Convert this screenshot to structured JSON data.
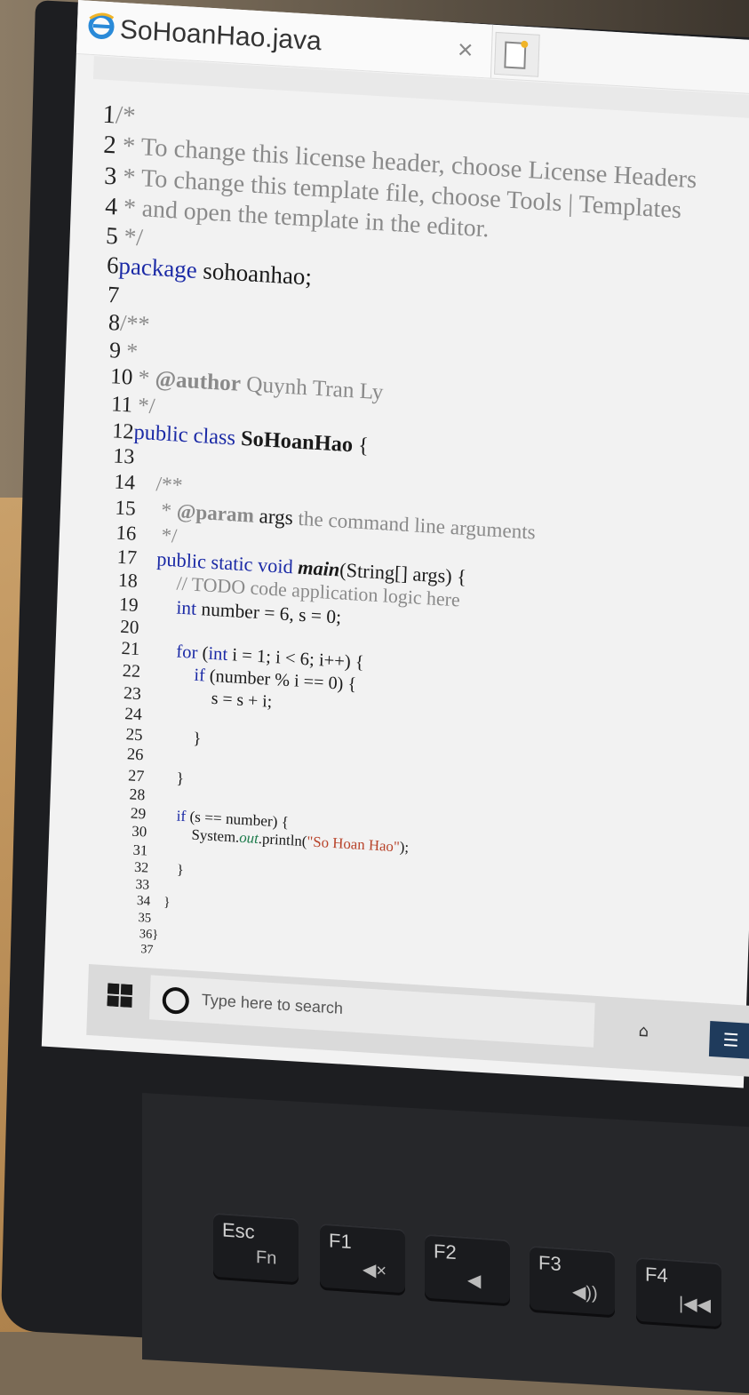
{
  "tab": {
    "title": "SoHoanHao.java",
    "close": "×"
  },
  "code_lines": [
    {
      "n": "1",
      "segs": [
        {
          "t": "/*",
          "c": "cm"
        }
      ]
    },
    {
      "n": "2",
      "segs": [
        {
          "t": " * To change this license header, choose License Headers",
          "c": "cm"
        }
      ]
    },
    {
      "n": "3",
      "segs": [
        {
          "t": " * To change this template file, choose Tools | Templates",
          "c": "cm"
        }
      ]
    },
    {
      "n": "4",
      "segs": [
        {
          "t": " * and open the template in the editor.",
          "c": "cm"
        }
      ]
    },
    {
      "n": "5",
      "segs": [
        {
          "t": " */",
          "c": "cm"
        }
      ]
    },
    {
      "n": "6",
      "segs": [
        {
          "t": "package",
          "c": "kw"
        },
        {
          "t": " sohoanhao;",
          "c": ""
        }
      ]
    },
    {
      "n": "7",
      "segs": []
    },
    {
      "n": "8",
      "segs": [
        {
          "t": "/**",
          "c": "cm"
        }
      ]
    },
    {
      "n": "9",
      "segs": [
        {
          "t": " *",
          "c": "cm"
        }
      ]
    },
    {
      "n": "10",
      "segs": [
        {
          "t": " * ",
          "c": "cm"
        },
        {
          "t": "@author",
          "c": "cm bold"
        },
        {
          "t": " Quynh Tran Ly",
          "c": "cm"
        }
      ]
    },
    {
      "n": "11",
      "segs": [
        {
          "t": " */",
          "c": "cm"
        }
      ]
    },
    {
      "n": "12",
      "segs": [
        {
          "t": "public class",
          "c": "kw"
        },
        {
          "t": " SoHoanHao",
          "c": "bold"
        },
        {
          "t": " {",
          "c": ""
        }
      ]
    },
    {
      "n": "13",
      "segs": []
    },
    {
      "n": "14",
      "segs": [
        {
          "t": "    /**",
          "c": "cm"
        }
      ]
    },
    {
      "n": "15",
      "segs": [
        {
          "t": "     * ",
          "c": "cm"
        },
        {
          "t": "@param",
          "c": "cm bold"
        },
        {
          "t": " args",
          "c": ""
        },
        {
          "t": " the command line arguments",
          "c": "cm"
        }
      ]
    },
    {
      "n": "16",
      "segs": [
        {
          "t": "     */",
          "c": "cm"
        }
      ]
    },
    {
      "n": "17",
      "segs": [
        {
          "t": "    public static void",
          "c": "kw"
        },
        {
          "t": " main",
          "c": "bold it"
        },
        {
          "t": "(String[] args) {",
          "c": ""
        }
      ]
    },
    {
      "n": "18",
      "segs": [
        {
          "t": "        // TODO code application logic here",
          "c": "cm"
        }
      ]
    },
    {
      "n": "19",
      "segs": [
        {
          "t": "        int",
          "c": "kw"
        },
        {
          "t": " number = 6, s = 0;",
          "c": ""
        }
      ]
    },
    {
      "n": "20",
      "segs": []
    },
    {
      "n": "21",
      "segs": [
        {
          "t": "        for",
          "c": "kw"
        },
        {
          "t": " (",
          "c": ""
        },
        {
          "t": "int",
          "c": "kw"
        },
        {
          "t": " i = 1; i < 6; i++) {",
          "c": ""
        }
      ]
    },
    {
      "n": "22",
      "segs": [
        {
          "t": "            if",
          "c": "kw"
        },
        {
          "t": " (number % i == 0) {",
          "c": ""
        }
      ]
    },
    {
      "n": "23",
      "segs": [
        {
          "t": "                s = s + i;",
          "c": ""
        }
      ]
    },
    {
      "n": "24",
      "segs": []
    },
    {
      "n": "25",
      "segs": [
        {
          "t": "            }",
          "c": ""
        }
      ]
    },
    {
      "n": "26",
      "segs": []
    },
    {
      "n": "27",
      "segs": [
        {
          "t": "        }",
          "c": ""
        }
      ]
    },
    {
      "n": "28",
      "segs": []
    },
    {
      "n": "29",
      "segs": [
        {
          "t": "        if",
          "c": "kw"
        },
        {
          "t": " (s == number) {",
          "c": ""
        }
      ]
    },
    {
      "n": "30",
      "segs": [
        {
          "t": "            System.",
          "c": ""
        },
        {
          "t": "out",
          "c": "out"
        },
        {
          "t": ".println(",
          "c": ""
        },
        {
          "t": "\"So Hoan Hao\"",
          "c": "str"
        },
        {
          "t": ");",
          "c": ""
        }
      ]
    },
    {
      "n": "31",
      "segs": []
    },
    {
      "n": "32",
      "segs": [
        {
          "t": "        }",
          "c": ""
        }
      ]
    },
    {
      "n": "33",
      "segs": []
    },
    {
      "n": "34",
      "segs": [
        {
          "t": "    }",
          "c": ""
        }
      ]
    },
    {
      "n": "35",
      "segs": []
    },
    {
      "n": "36",
      "segs": [
        {
          "t": "}",
          "c": ""
        }
      ]
    },
    {
      "n": "37",
      "segs": []
    }
  ],
  "taskbar": {
    "search_placeholder": "Type here to search"
  },
  "keys": [
    {
      "label": "Esc",
      "sub": "Fn"
    },
    {
      "label": "F1",
      "sub": "◀×"
    },
    {
      "label": "F2",
      "sub": "◀"
    },
    {
      "label": "F3",
      "sub": "◀))"
    },
    {
      "label": "F4",
      "sub": "|◀◀"
    }
  ],
  "icons": {
    "browser": "internet-explorer-icon",
    "windows": "windows-logo-icon",
    "search": "cortana-circle-icon"
  }
}
